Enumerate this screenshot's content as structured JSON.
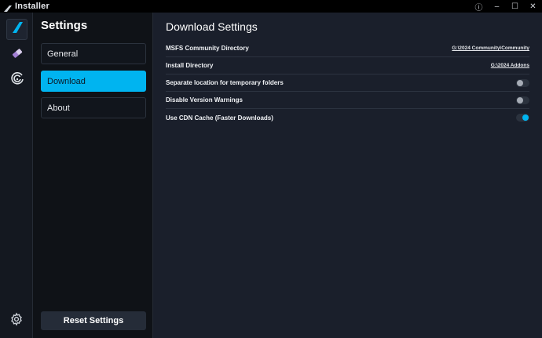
{
  "window": {
    "title": "Installer",
    "buttons": [
      "ⓘ",
      "–",
      "☐",
      "✕"
    ]
  },
  "sidebar": {
    "title": "Settings",
    "items": [
      {
        "label": "General",
        "active": false
      },
      {
        "label": "Download",
        "active": true
      },
      {
        "label": "About",
        "active": false
      }
    ],
    "reset_label": "Reset Settings"
  },
  "main": {
    "title": "Download Settings",
    "rows": [
      {
        "label": "MSFS Community Directory",
        "value": "G:\\2024 Community\\Community"
      },
      {
        "label": "Install Directory",
        "value": "G:\\2024 Addons"
      },
      {
        "label": "Separate location for temporary folders",
        "toggle": false
      },
      {
        "label": "Disable Version Warnings",
        "toggle": false
      },
      {
        "label": "Use CDN Cache (Faster Downloads)",
        "toggle": true
      }
    ]
  },
  "colors": {
    "accent": "#00b4f0",
    "sidebar_bg": "#0f1217",
    "main_bg": "#1a1f2b"
  },
  "icons": {
    "rail": [
      "flybywire-logo-icon",
      "eraser-icon",
      "target-logo-icon"
    ],
    "rail_bottom": "gear-icon"
  }
}
